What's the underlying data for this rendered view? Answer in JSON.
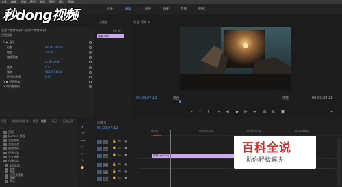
{
  "logo": {
    "text": "秒dong视频"
  },
  "menubar": {
    "items": [
      "文件",
      "编辑",
      "剪辑",
      "序列",
      "标记",
      "图形",
      "窗口",
      "帮助"
    ]
  },
  "workspaces": [
    {
      "label": "组件",
      "active": false
    },
    {
      "label": "编辑",
      "active": true
    },
    {
      "label": "颜色",
      "active": false
    },
    {
      "label": "效果",
      "active": false
    },
    {
      "label": "音频",
      "active": false
    },
    {
      "label": "图形",
      "active": false
    }
  ],
  "effect_controls": {
    "tab_label": "效果控件 ≡",
    "source_label": "主要 * 剪辑.mp4 › 序列 * 剪辑.mp4",
    "header_label": "视频效果",
    "mini_clip_label": "剪辑.mp4",
    "mini_time": "00:00",
    "rows": [
      {
        "label": "fx  ▶ 运动",
        "value": ""
      },
      {
        "label": "位置",
        "value": "960.0  540.0"
      },
      {
        "label": "缩放",
        "value": "100.0"
      },
      {
        "label": "缩放宽度",
        "value": ""
      },
      {
        "label": "",
        "value": "☑ 等比缩放"
      },
      {
        "label": "旋转",
        "value": "0.0"
      },
      {
        "label": "锚点",
        "value": "960.0  540.0"
      },
      {
        "label": "防闪烁滤镜",
        "value": "0.00"
      },
      {
        "label": "fx  ▶ 不透明度",
        "value": ""
      },
      {
        "label": "fx  时间重映射",
        "value": ""
      }
    ]
  },
  "audio_meter": {
    "label": "元数据"
  },
  "program_monitor": {
    "tab_label": "节目: 剪辑 ≡",
    "timecode": "00;00;07;12",
    "fit_label": "适合",
    "zoom_label": "完整",
    "duration": "00;00;32;28"
  },
  "project_panel": {
    "tabs": [
      "项目",
      "媒体浏览器",
      "库",
      "信息",
      "效果",
      "标记",
      "历史记录"
    ],
    "items": [
      "预设",
      "Lumetri 预设",
      "音频效果",
      "音频过渡",
      "视频效果",
      "视频过渡",
      "交叉溶解",
      "白场过渡"
    ],
    "folders": [
      "3D 运动",
      "划像",
      "擦除",
      "沉浸式视频",
      "溶解",
      "滑动"
    ]
  },
  "timeline": {
    "tab_label": "剪辑 ≡",
    "timecode": "00;00;07;12",
    "ruler_labels": [
      "00;00",
      "00;00;16;00",
      "00;00;32;00",
      "00;00;48;00"
    ],
    "video_tracks": [
      "V3",
      "V2",
      "V1"
    ],
    "audio_tracks": [
      "A1",
      "A2",
      "A3"
    ],
    "clip_label": "剪辑.mp4 [V]"
  },
  "watermark": {
    "title": "百科全说",
    "subtitle": "助你轻松解决"
  },
  "colors": {
    "accent": "#2d8ceb",
    "timeline_blue": "#4a8cf0",
    "clip": "#c9a9e8",
    "playhead": "#3b78e7"
  }
}
